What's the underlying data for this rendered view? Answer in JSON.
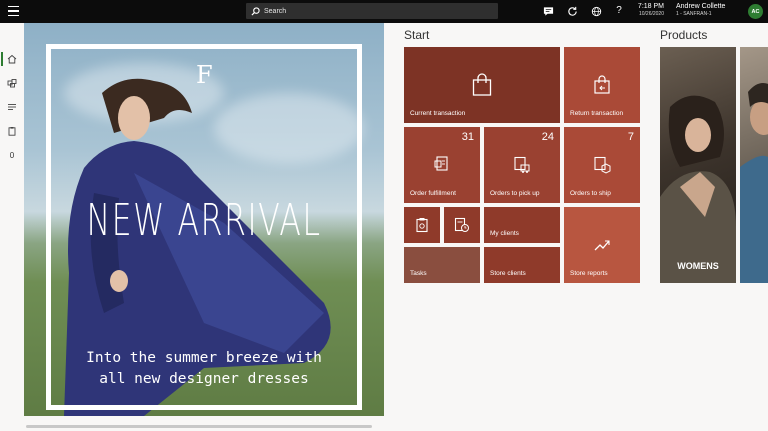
{
  "topbar": {
    "menu_icon": "hamburger-icon",
    "search_placeholder": "Search",
    "icons": [
      "chat-icon",
      "refresh-icon",
      "globe-icon",
      "help-icon"
    ],
    "help_glyph": "?",
    "time": "7:18 PM",
    "date": "10/26/2020",
    "user_name": "Andrew Collette",
    "store": "1 - SANFRAN-1",
    "avatar_initials": "AC"
  },
  "rail": {
    "items": [
      "home-icon",
      "products-icon",
      "list-icon",
      "clipboard-icon"
    ],
    "count": "0"
  },
  "hero": {
    "logo": "F",
    "headline": "NEW ARRIVAL",
    "tagline_line1": "Into the summer breeze with",
    "tagline_line2": "all new designer dresses"
  },
  "start": {
    "title": "Start",
    "tiles": {
      "current_transaction": {
        "label": "Current transaction"
      },
      "return_transaction": {
        "label": "Return transaction"
      },
      "order_fulfillment": {
        "label": "Order fulfillment",
        "count": "31"
      },
      "orders_pick_up": {
        "label": "Orders to pick up",
        "count": "24"
      },
      "orders_ship": {
        "label": "Orders to ship",
        "count": "7"
      },
      "my_clients": {
        "label": "My clients"
      },
      "tasks": {
        "label": "Tasks"
      },
      "store_clients": {
        "label": "Store clients"
      },
      "store_reports": {
        "label": "Store reports"
      }
    }
  },
  "products": {
    "title": "Products",
    "items": [
      {
        "label": "WOMENS"
      },
      {
        "label": ""
      }
    ]
  },
  "colors": {
    "accent_green": "#2e7d32",
    "tile_dark": "#7d3325",
    "tile_mid": "#9a4131",
    "tile_light": "#b85640"
  }
}
